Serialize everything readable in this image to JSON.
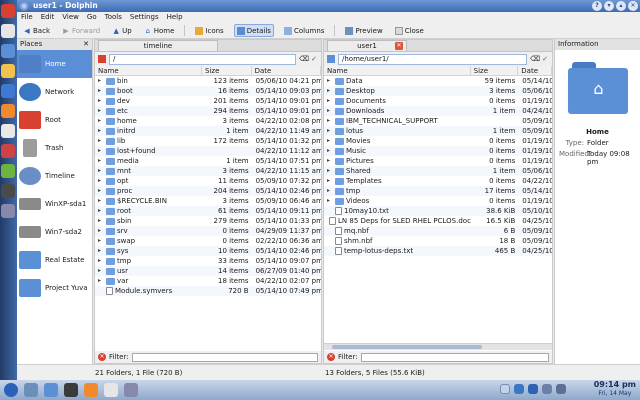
{
  "window": {
    "title": "user1 - Dolphin"
  },
  "menu": [
    "File",
    "Edit",
    "View",
    "Go",
    "Tools",
    "Settings",
    "Help"
  ],
  "toolbar": {
    "back": "Back",
    "forward": "Forward",
    "up": "Up",
    "home": "Home",
    "icons": "Icons",
    "details": "Details",
    "columns": "Columns",
    "preview": "Preview",
    "close": "Close"
  },
  "places": {
    "title": "Places",
    "items": [
      {
        "label": "Home",
        "color": "#4f7fc9"
      },
      {
        "label": "Network",
        "color": "#3b78c4"
      },
      {
        "label": "Root",
        "color": "#d8402f"
      },
      {
        "label": "Trash",
        "color": "#9c9c9c"
      },
      {
        "label": "Timeline",
        "color": "#6b8fc4"
      },
      {
        "label": "WinXP-sda1",
        "color": "#8a8a8a"
      },
      {
        "label": "Win7-sda2",
        "color": "#8a8a8a"
      },
      {
        "label": "Real Estate",
        "color": "#5b8fd6"
      },
      {
        "label": "Project Yuva",
        "color": "#5b8fd6"
      }
    ]
  },
  "left_pane": {
    "tab": "timeline",
    "url": "/",
    "headers": {
      "name": "Name",
      "size": "Size",
      "date": "Date"
    },
    "rows": [
      {
        "name": "bin",
        "size": "123 items",
        "date": "05/06/10 04:21 pm",
        "type": "folder"
      },
      {
        "name": "boot",
        "size": "16 items",
        "date": "05/14/10 09:03 pm",
        "type": "folder"
      },
      {
        "name": "dev",
        "size": "201 items",
        "date": "05/14/10 09:01 pm",
        "type": "folder"
      },
      {
        "name": "etc",
        "size": "294 items",
        "date": "05/14/10 09:01 pm",
        "type": "folder"
      },
      {
        "name": "home",
        "size": "3 items",
        "date": "04/22/10 02:08 pm",
        "type": "folder"
      },
      {
        "name": "initrd",
        "size": "1 item",
        "date": "04/22/10 11:49 am",
        "type": "folder"
      },
      {
        "name": "lib",
        "size": "172 items",
        "date": "05/14/10 01:32 pm",
        "type": "folder"
      },
      {
        "name": "lost+found",
        "size": "",
        "date": "04/22/10 11:12 am",
        "type": "folder"
      },
      {
        "name": "media",
        "size": "1 item",
        "date": "05/14/10 07:51 pm",
        "type": "folder"
      },
      {
        "name": "mnt",
        "size": "3 items",
        "date": "04/22/10 11:15 am",
        "type": "folder"
      },
      {
        "name": "opt",
        "size": "11 items",
        "date": "05/09/10 07:32 pm",
        "type": "folder"
      },
      {
        "name": "proc",
        "size": "204 items",
        "date": "05/14/10 02:46 pm",
        "type": "folder"
      },
      {
        "name": "$RECYCLE.BIN",
        "size": "3 items",
        "date": "05/09/10 06:46 am",
        "type": "folder"
      },
      {
        "name": "root",
        "size": "61 items",
        "date": "05/14/10 09:11 pm",
        "type": "folder"
      },
      {
        "name": "sbin",
        "size": "279 items",
        "date": "05/14/10 01:33 pm",
        "type": "folder"
      },
      {
        "name": "srv",
        "size": "0 items",
        "date": "04/29/09 11:37 pm",
        "type": "folder"
      },
      {
        "name": "swap",
        "size": "0 items",
        "date": "02/22/10 06:36 am",
        "type": "folder"
      },
      {
        "name": "sys",
        "size": "10 items",
        "date": "05/14/10 02:46 pm",
        "type": "folder"
      },
      {
        "name": "tmp",
        "size": "33 items",
        "date": "05/14/10 09:07 pm",
        "type": "folder"
      },
      {
        "name": "usr",
        "size": "14 items",
        "date": "06/27/09 01:40 pm",
        "type": "folder"
      },
      {
        "name": "var",
        "size": "18 items",
        "date": "04/22/10 02:07 pm",
        "type": "folder"
      },
      {
        "name": "Module.symvers",
        "size": "720 B",
        "date": "05/14/10 07:49 pm",
        "type": "file"
      }
    ],
    "filter_label": "Filter:",
    "status": "21 Folders, 1 File (720 B)"
  },
  "right_pane": {
    "tab": "user1",
    "url": "/home/user1/",
    "headers": {
      "name": "Name",
      "size": "Size",
      "date": "Date"
    },
    "rows": [
      {
        "name": "Data",
        "size": "59 items",
        "date": "05/14/10",
        "type": "folder"
      },
      {
        "name": "Desktop",
        "size": "3 items",
        "date": "05/06/10",
        "type": "folder"
      },
      {
        "name": "Documents",
        "size": "0 items",
        "date": "01/19/10",
        "type": "folder"
      },
      {
        "name": "Downloads",
        "size": "1 item",
        "date": "04/24/10",
        "type": "folder"
      },
      {
        "name": "IBM_TECHNICAL_SUPPORT",
        "size": "",
        "date": "05/09/10",
        "type": "folder"
      },
      {
        "name": "lotus",
        "size": "1 item",
        "date": "05/09/10",
        "type": "folder"
      },
      {
        "name": "Movies",
        "size": "0 items",
        "date": "01/19/10",
        "type": "folder"
      },
      {
        "name": "Music",
        "size": "0 items",
        "date": "01/19/10",
        "type": "folder"
      },
      {
        "name": "Pictures",
        "size": "0 items",
        "date": "01/19/10",
        "type": "folder"
      },
      {
        "name": "Shared",
        "size": "1 item",
        "date": "05/06/10",
        "type": "folder"
      },
      {
        "name": "Templates",
        "size": "0 items",
        "date": "04/22/10",
        "type": "folder"
      },
      {
        "name": "tmp",
        "size": "17 items",
        "date": "05/14/10",
        "type": "folder"
      },
      {
        "name": "Videos",
        "size": "0 items",
        "date": "01/19/10",
        "type": "folder"
      },
      {
        "name": "10may10.txt",
        "size": "38.6 KiB",
        "date": "05/10/10",
        "type": "file"
      },
      {
        "name": "LN 85 Deps for SLED RHEL PCLOS.doc",
        "size": "16.5 KiB",
        "date": "04/25/10",
        "type": "file"
      },
      {
        "name": "mq.nbf",
        "size": "6 B",
        "date": "05/09/10",
        "type": "file"
      },
      {
        "name": "shm.nbf",
        "size": "18 B",
        "date": "05/09/10",
        "type": "file"
      },
      {
        "name": "temp-lotus-deps.txt",
        "size": "465 B",
        "date": "04/25/10",
        "type": "file"
      }
    ],
    "filter_label": "Filter:",
    "status": "13 Folders, 5 Files (55.6 KiB)"
  },
  "info": {
    "title": "Information",
    "name": "Home",
    "type_label": "Type:",
    "type_value": "Folder",
    "modified_label": "Modified:",
    "modified_value": "Today 09:08 pm"
  },
  "clock": {
    "time": "09:14 pm",
    "date": "Fri, 14 May"
  },
  "taskbar_icons": [
    "pc-icon",
    "home-icon",
    "browser-icon",
    "terminal-icon",
    "mail-icon",
    "network-icon",
    "volume-icon",
    "bluetooth-icon"
  ]
}
